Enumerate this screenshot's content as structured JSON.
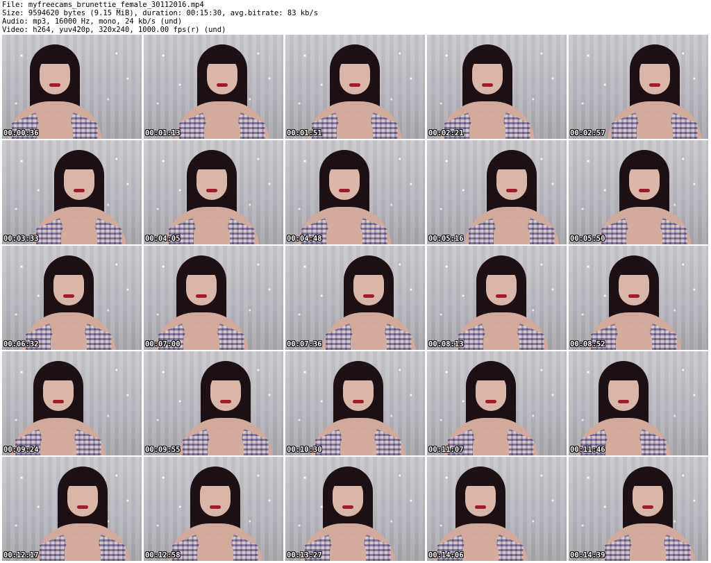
{
  "header": {
    "file_line": "File: myfreecams_brunettie_female_30112016.mp4",
    "size_line": "Size: 9594620 bytes (9.15 MiB), duration: 00:15:30, avg.bitrate: 83 kb/s",
    "audio_line": "Audio: mp3, 16000 Hz, mono, 24 kb/s (und)",
    "video_line": "Video: h264, yuv420p, 320x240, 1000.00 fps(r) (und)"
  },
  "thumbnails": [
    {
      "timestamp": "00:00:36"
    },
    {
      "timestamp": "00:01:13"
    },
    {
      "timestamp": "00:01:51"
    },
    {
      "timestamp": "00:02:21"
    },
    {
      "timestamp": "00:02:57"
    },
    {
      "timestamp": "00:03:33"
    },
    {
      "timestamp": "00:04:05"
    },
    {
      "timestamp": "00:04:48"
    },
    {
      "timestamp": "00:05:16"
    },
    {
      "timestamp": "00:05:50"
    },
    {
      "timestamp": "00:06:32"
    },
    {
      "timestamp": "00:07:00"
    },
    {
      "timestamp": "00:07:36"
    },
    {
      "timestamp": "00:08:13"
    },
    {
      "timestamp": "00:08:52"
    },
    {
      "timestamp": "00:09:24"
    },
    {
      "timestamp": "00:09:55"
    },
    {
      "timestamp": "00:10:30"
    },
    {
      "timestamp": "00:11:07"
    },
    {
      "timestamp": "00:11:46"
    },
    {
      "timestamp": "00:12:17"
    },
    {
      "timestamp": "00:12:58"
    },
    {
      "timestamp": "00:13:27"
    },
    {
      "timestamp": "00:14:06"
    },
    {
      "timestamp": "00:14:39"
    }
  ]
}
